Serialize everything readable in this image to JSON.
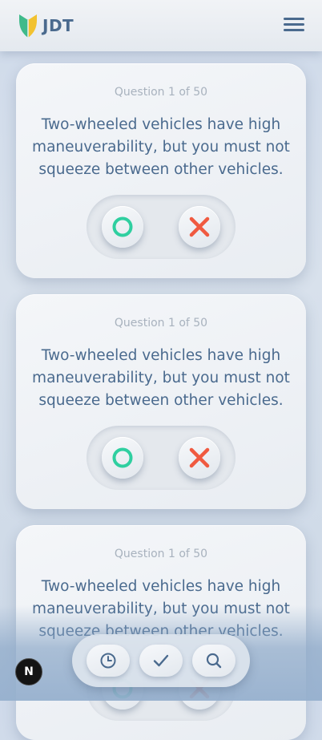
{
  "header": {
    "logo_text": "JDT",
    "logo_icon": "shield-leaf-icon",
    "menu_icon": "hamburger-menu-icon"
  },
  "cards": [
    {
      "question_number": "Question 1 of 50",
      "question_text": "Two-wheeled vehicles have high maneuverability, but you must not squeeze between other vehicles.",
      "true_icon": "circle-true-icon",
      "false_icon": "cross-false-icon"
    },
    {
      "question_number": "Question 1 of 50",
      "question_text": "Two-wheeled vehicles have high maneuverability, but you must not squeeze between other vehicles.",
      "true_icon": "circle-true-icon",
      "false_icon": "cross-false-icon"
    },
    {
      "question_number": "Question 1 of 50",
      "question_text": "Two-wheeled vehicles have high maneuverability, but you must not squeeze between other vehicles.",
      "true_icon": "circle-true-icon",
      "false_icon": "cross-false-icon"
    }
  ],
  "bottom_nav": {
    "items": [
      {
        "icon": "clock-icon"
      },
      {
        "icon": "check-icon"
      },
      {
        "icon": "search-icon"
      }
    ]
  },
  "badge": {
    "letter": "N"
  },
  "colors": {
    "accent": "#4a6a8e",
    "true_green": "#2fcfa0",
    "false_red": "#f05a40",
    "muted_text": "#a8b2be",
    "logo_green": "#3fba8a",
    "logo_yellow": "#f2c230"
  }
}
